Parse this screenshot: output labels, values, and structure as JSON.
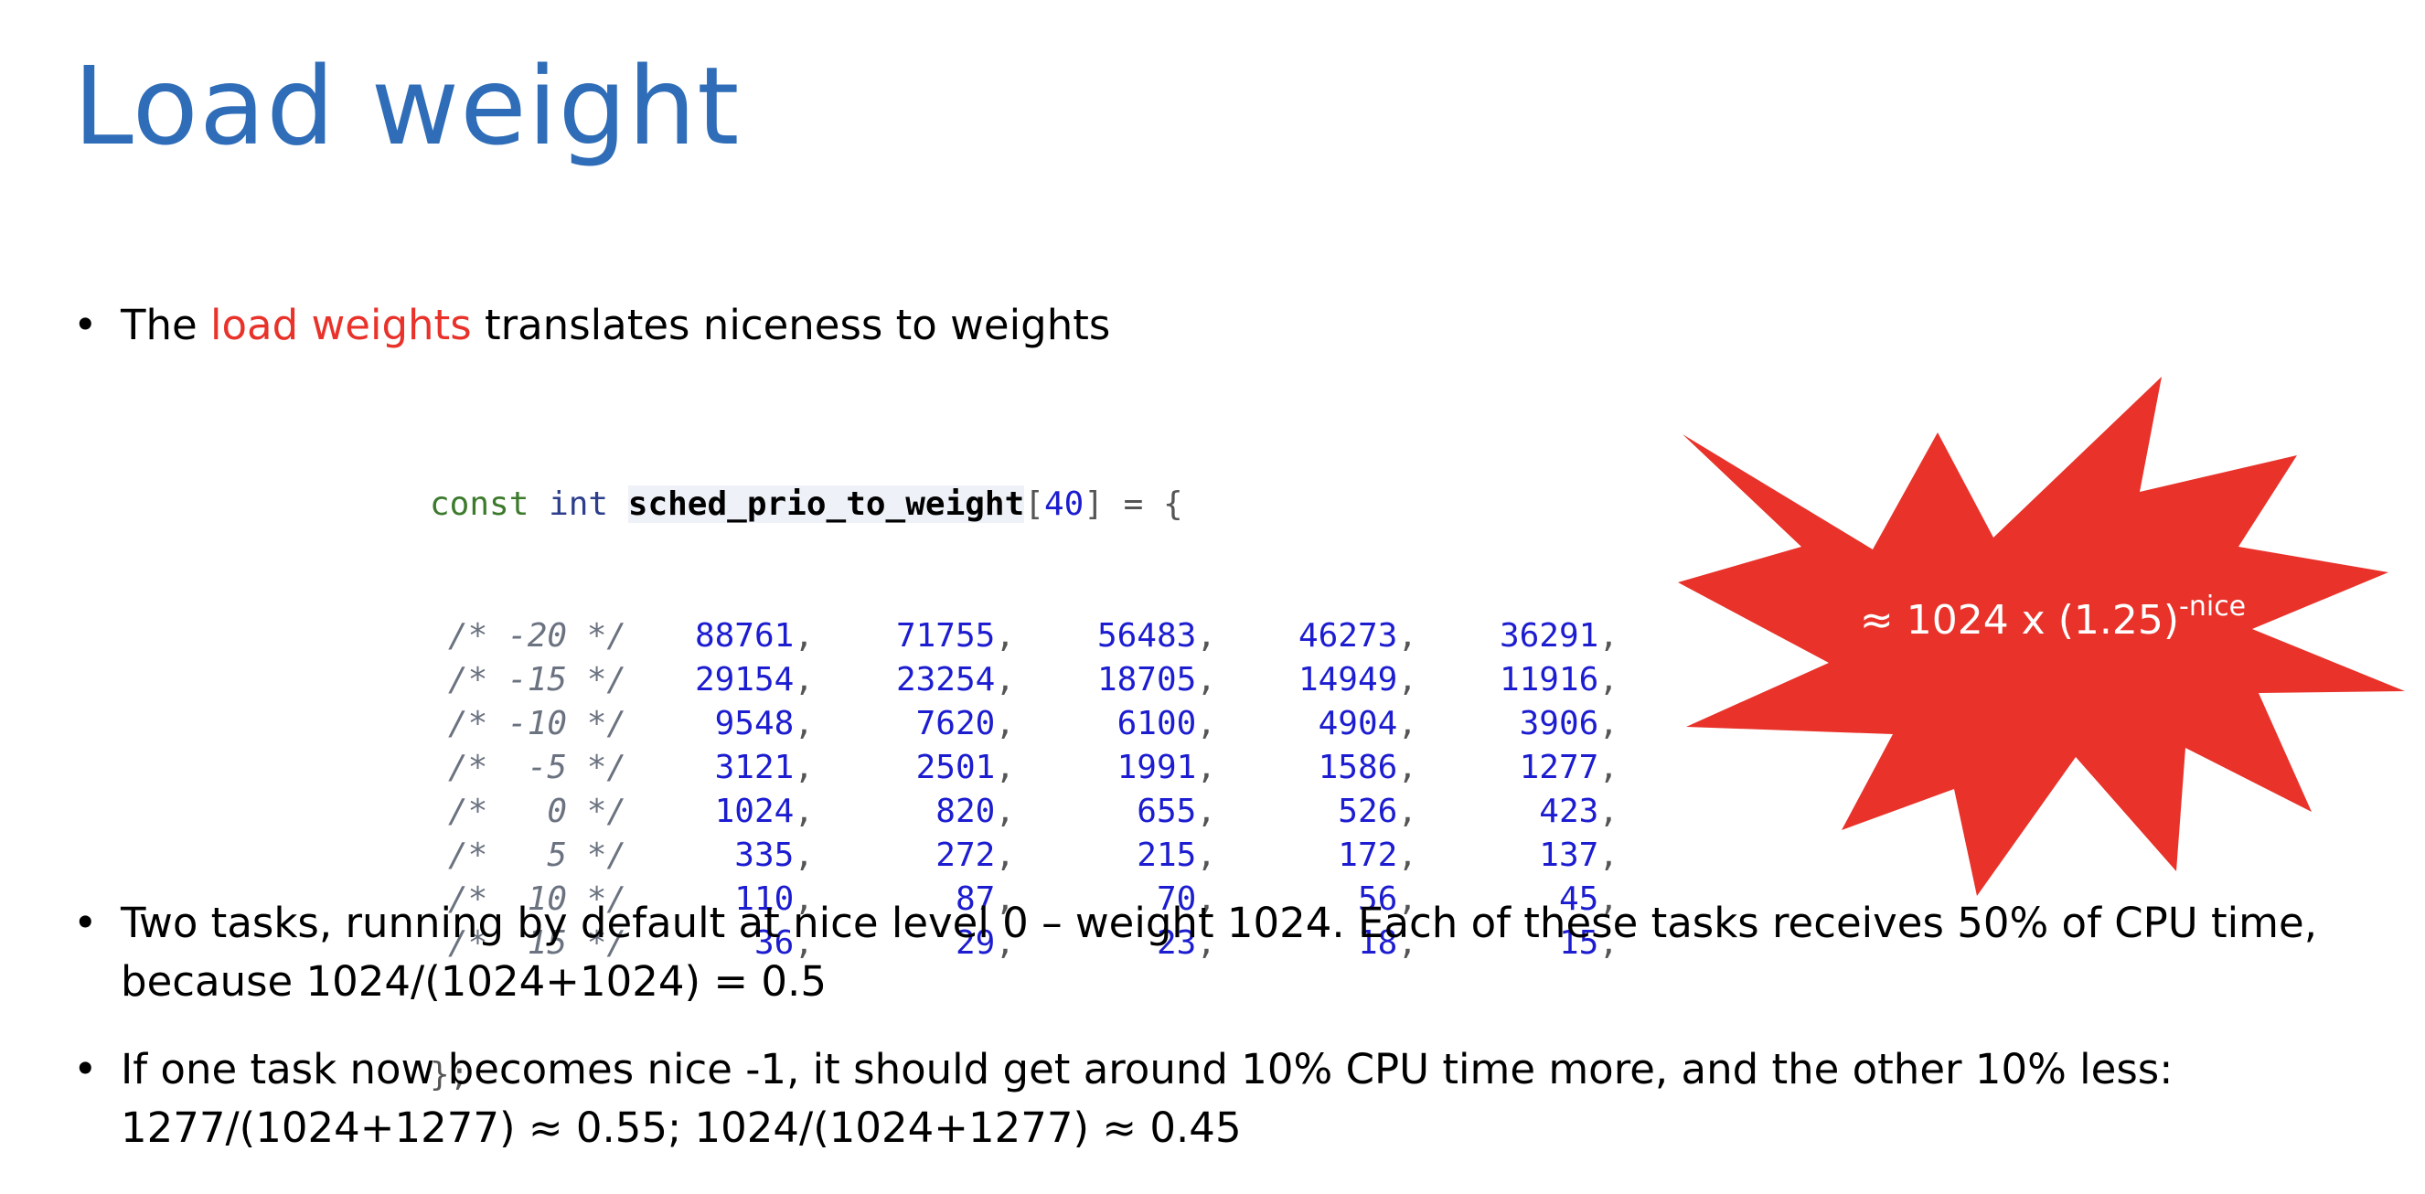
{
  "slide": {
    "title": "Load weight",
    "accent_color": "#2f6db8",
    "highlight_color": "#e8322a",
    "star_color": "#e8322a"
  },
  "bullets": [
    {
      "prefix": "The ",
      "highlight": "load weights",
      "suffix": " translates niceness to weights"
    },
    {
      "line1": "Two tasks, running by default at nice level 0 – weight 1024. Each of these tasks receives 50% of CPU time,",
      "line2": "because 1024/(1024+1024) = 0.5"
    },
    {
      "line1": "If one task now becomes nice -1, it should get around 10% CPU time more, and the other 10% less:",
      "line2": "1277/(1024+1277) ≈ 0.55; 1024/(1024+1277) ≈ 0.45"
    }
  ],
  "code": {
    "kw_const": "const",
    "kw_int": "int",
    "identifier": "sched_prio_to_weight",
    "open_bracket": "[",
    "size": "40",
    "close_bracket_assign": "] = {",
    "closing": "};",
    "rows": [
      {
        "comment": "/* -20 */",
        "values": [
          "88761",
          "71755",
          "56483",
          "46273",
          "36291"
        ]
      },
      {
        "comment": "/* -15 */",
        "values": [
          "29154",
          "23254",
          "18705",
          "14949",
          "11916"
        ]
      },
      {
        "comment": "/* -10 */",
        "values": [
          "9548",
          "7620",
          "6100",
          "4904",
          "3906"
        ]
      },
      {
        "comment": "/*  -5 */",
        "values": [
          "3121",
          "2501",
          "1991",
          "1586",
          "1277"
        ]
      },
      {
        "comment": "/*   0 */",
        "values": [
          "1024",
          "820",
          "655",
          "526",
          "423"
        ]
      },
      {
        "comment": "/*   5 */",
        "values": [
          "335",
          "272",
          "215",
          "172",
          "137"
        ]
      },
      {
        "comment": "/*  10 */",
        "values": [
          "110",
          "87",
          "70",
          "56",
          "45"
        ]
      },
      {
        "comment": "/*  15 */",
        "values": [
          "36",
          "29",
          "23",
          "18",
          "15"
        ]
      }
    ]
  },
  "callout": {
    "formula": "≈ 1024 x (1.25)",
    "exponent": "-nice"
  }
}
